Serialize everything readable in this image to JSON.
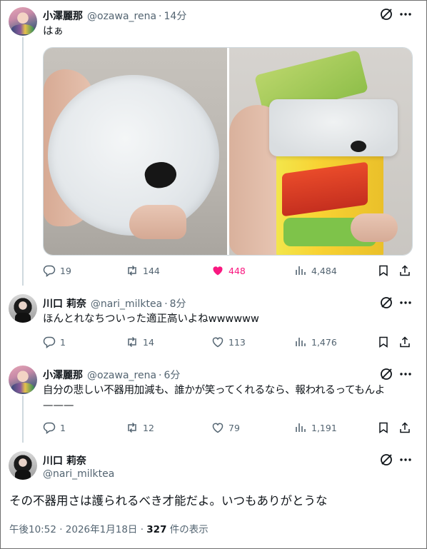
{
  "tweets": [
    {
      "name": "小澤麗那",
      "handle": "@ozawa_rena",
      "time": "14分",
      "text": "はぁ",
      "replies": "19",
      "retweets": "144",
      "likes": "448",
      "views": "4,484"
    },
    {
      "name": "川口 莉奈",
      "handle": "@nari_milktea",
      "time": "8分",
      "text": "ほんとれなちついった適正高いよねwwwwww",
      "replies": "1",
      "retweets": "14",
      "likes": "113",
      "views": "1,476"
    },
    {
      "name": "小澤麗那",
      "handle": "@ozawa_rena",
      "time": "6分",
      "text_line1": "自分の悲しい不器用加減も、誰かが笑ってくれるなら、報われるってもんよ",
      "text_line2": "———",
      "replies": "1",
      "retweets": "12",
      "likes": "79",
      "views": "1,191"
    }
  ],
  "main_tweet": {
    "name": "川口 莉奈",
    "handle": "@nari_milktea",
    "text": "その不器用さは護られるべき才能だよ。いつもありがとうな",
    "timestamp": "午後10:52 · 2026年1月18日 · ",
    "view_count": "327",
    "view_label": " 件の表示"
  },
  "colors": {
    "like_active": "#f91880",
    "secondary_text": "#536471",
    "primary_text": "#0f1419"
  },
  "icons": {
    "reply": "reply-icon",
    "retweet": "retweet-icon",
    "like": "heart-icon",
    "views": "views-icon",
    "bookmark": "bookmark-icon",
    "share": "share-icon",
    "grok": "grok-icon",
    "more": "more-icon"
  }
}
